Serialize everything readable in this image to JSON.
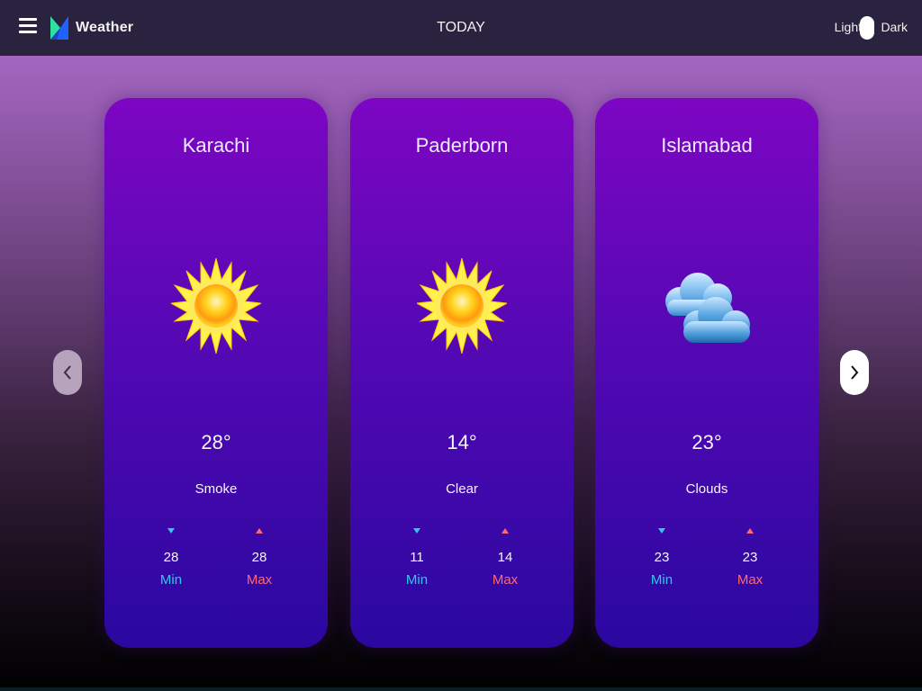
{
  "header": {
    "menu_icon": "hamburger-menu-icon",
    "logo_icon": "weather-logo-icon",
    "brand": "Weather",
    "title": "TODAY",
    "theme": {
      "light_label": "Light",
      "dark_label": "Dark",
      "selected": "Light"
    }
  },
  "carousel": {
    "prev_icon": "chevron-left-icon",
    "next_icon": "chevron-right-icon"
  },
  "cards": [
    {
      "city": "Karachi",
      "icon": "sun-icon",
      "temp": "28°",
      "description": "Smoke",
      "min": "28",
      "max": "28",
      "min_label": "Min",
      "max_label": "Max"
    },
    {
      "city": "Paderborn",
      "icon": "sun-icon",
      "temp": "14°",
      "description": "Clear",
      "min": "11",
      "max": "14",
      "min_label": "Min",
      "max_label": "Max"
    },
    {
      "city": "Islamabad",
      "icon": "clouds-icon",
      "temp": "23°",
      "description": "Clouds",
      "min": "23",
      "max": "23",
      "min_label": "Min",
      "max_label": "Max"
    }
  ],
  "colors": {
    "min": "#33c6e8",
    "max": "#ff6a72",
    "topbar": "#29233f"
  }
}
